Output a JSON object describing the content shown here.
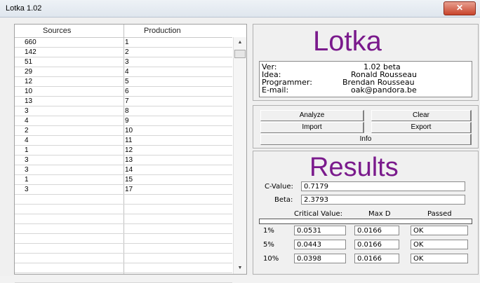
{
  "window": {
    "title": "Lotka 1.02",
    "close_label": "✕"
  },
  "grid": {
    "headers": [
      "Sources",
      "Production"
    ],
    "rows": [
      [
        "660",
        "1"
      ],
      [
        "142",
        "2"
      ],
      [
        "51",
        "3"
      ],
      [
        "29",
        "4"
      ],
      [
        "12",
        "5"
      ],
      [
        "10",
        "6"
      ],
      [
        "13",
        "7"
      ],
      [
        "3",
        "8"
      ],
      [
        "4",
        "9"
      ],
      [
        "2",
        "10"
      ],
      [
        "4",
        "11"
      ],
      [
        "1",
        "12"
      ],
      [
        "3",
        "13"
      ],
      [
        "3",
        "14"
      ],
      [
        "1",
        "15"
      ],
      [
        "3",
        "17"
      ],
      [
        "",
        ""
      ],
      [
        "",
        ""
      ],
      [
        "",
        ""
      ],
      [
        "",
        ""
      ],
      [
        "",
        ""
      ],
      [
        "",
        ""
      ],
      [
        "",
        ""
      ],
      [
        "",
        ""
      ],
      [
        "",
        ""
      ]
    ]
  },
  "about": {
    "logo": "Lotka",
    "ver_label": "Ver:",
    "ver_value": "1.02 beta",
    "idea_label": "Idea:",
    "idea_value": "Ronald Rousseau",
    "programmer_label": "Programmer:",
    "programmer_value": "Brendan Rousseau",
    "email_label": "E-mail:",
    "email_value": "oak@pandora.be"
  },
  "buttons": {
    "analyze": "Analyze",
    "clear": "Clear",
    "import": "Import",
    "export": "Export",
    "info": "Info"
  },
  "results": {
    "title": "Results",
    "cvalue_label": "C-Value:",
    "cvalue": "0.7179",
    "beta_label": "Beta:",
    "beta": "2.3793",
    "col_critical": "Critical Value:",
    "col_maxd": "Max D",
    "col_passed": "Passed",
    "rows": [
      {
        "level": "1%",
        "critical": "0.0531",
        "maxd": "0.0166",
        "passed": "OK"
      },
      {
        "level": "5%",
        "critical": "0.0443",
        "maxd": "0.0166",
        "passed": "OK"
      },
      {
        "level": "10%",
        "critical": "0.0398",
        "maxd": "0.0166",
        "passed": "OK"
      }
    ]
  },
  "colors": {
    "accent": "#7a1a8c"
  }
}
